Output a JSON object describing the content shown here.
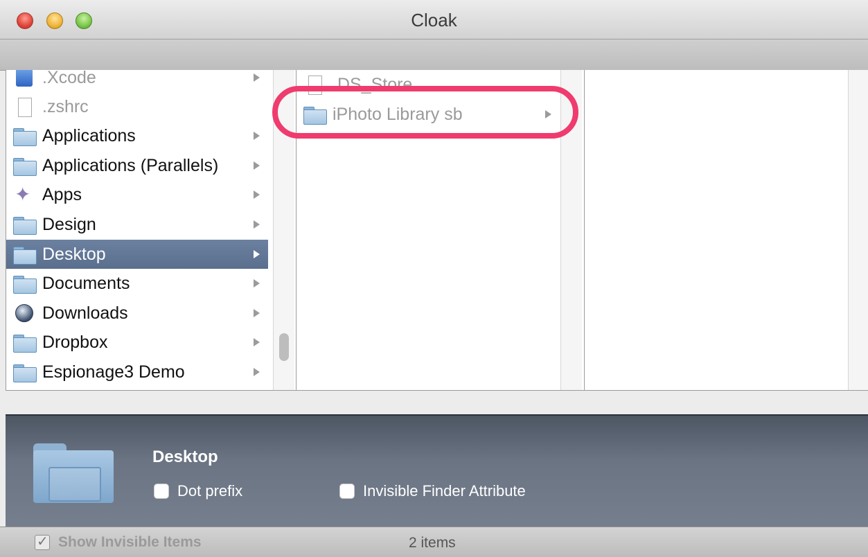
{
  "window": {
    "title": "Cloak"
  },
  "columns": {
    "column1": {
      "items": [
        {
          "label": ".Xcode",
          "icon": "xcode-icon",
          "dim": true,
          "has_children": true
        },
        {
          "label": ".zshrc",
          "icon": "file-icon",
          "dim": true,
          "has_children": false
        },
        {
          "label": "Applications",
          "icon": "folder-icon",
          "dim": false,
          "has_children": true
        },
        {
          "label": "Applications (Parallels)",
          "icon": "folder-icon",
          "dim": false,
          "has_children": true
        },
        {
          "label": "Apps",
          "icon": "apps-icon",
          "dim": false,
          "has_children": true
        },
        {
          "label": "Design",
          "icon": "folder-icon",
          "dim": false,
          "has_children": true
        },
        {
          "label": "Desktop",
          "icon": "folder-icon",
          "dim": false,
          "has_children": true,
          "selected": true
        },
        {
          "label": "Documents",
          "icon": "folder-icon",
          "dim": false,
          "has_children": true
        },
        {
          "label": "Downloads",
          "icon": "globe-icon",
          "dim": false,
          "has_children": true
        },
        {
          "label": "Dropbox",
          "icon": "folder-icon",
          "dim": false,
          "has_children": true
        },
        {
          "label": "Espionage3 Demo",
          "icon": "folder-icon",
          "dim": false,
          "has_children": true
        }
      ]
    },
    "column2": {
      "items": [
        {
          "label": ".DS_Store",
          "icon": "file-icon",
          "dim": true,
          "has_children": false
        },
        {
          "label": "iPhoto Library sb",
          "icon": "folder-icon",
          "dim": true,
          "has_children": true
        }
      ]
    }
  },
  "info": {
    "name": "Desktop",
    "dot_prefix_label": "Dot prefix",
    "invisible_attr_label": "Invisible Finder Attribute"
  },
  "status": {
    "show_invisible_label": "Show Invisible Items",
    "items_count": "2 items"
  },
  "colors": {
    "highlight": "#ef3b6e",
    "selection": "#5f7392"
  }
}
